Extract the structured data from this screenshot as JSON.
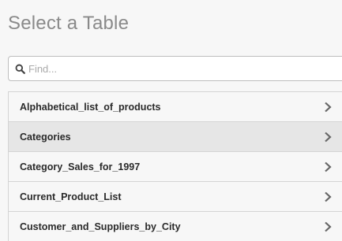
{
  "header": {
    "title": "Select a Table"
  },
  "search": {
    "placeholder": "Find...",
    "value": "",
    "icon": "search-icon"
  },
  "tables": {
    "items": [
      {
        "label": "Alphabetical_list_of_products",
        "selected": false,
        "icon": "chevron-right-icon"
      },
      {
        "label": "Categories",
        "selected": true,
        "icon": "chevron-right-icon"
      },
      {
        "label": "Category_Sales_for_1997",
        "selected": false,
        "icon": "chevron-right-icon"
      },
      {
        "label": "Current_Product_List",
        "selected": false,
        "icon": "chevron-right-icon"
      },
      {
        "label": "Customer_and_Suppliers_by_City",
        "selected": false,
        "icon": "chevron-right-icon"
      }
    ]
  },
  "colors": {
    "background": "#f7f7f7",
    "selected_row": "#e6e6e6",
    "title_text": "#8a8a8a",
    "chevron": "#666666"
  }
}
